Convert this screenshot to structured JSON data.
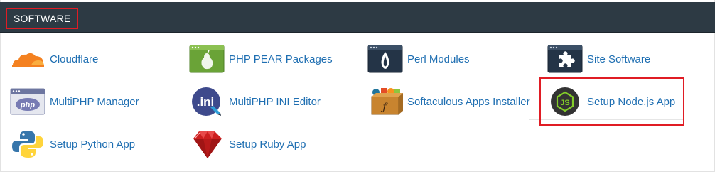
{
  "section": {
    "title": "SOFTWARE"
  },
  "items": [
    {
      "label": "Cloudflare",
      "icon": "cloudflare-icon"
    },
    {
      "label": "PHP PEAR Packages",
      "icon": "pear-icon"
    },
    {
      "label": "Perl Modules",
      "icon": "perl-onion-icon"
    },
    {
      "label": "Site Software",
      "icon": "puzzle-piece-icon"
    },
    {
      "label": "MultiPHP Manager",
      "icon": "php-window-icon"
    },
    {
      "label": "MultiPHP INI Editor",
      "icon": "ini-file-icon"
    },
    {
      "label": "Softaculous Apps Installer",
      "icon": "softaculous-box-icon"
    },
    {
      "label": "Setup Node.js App",
      "icon": "nodejs-icon"
    },
    {
      "label": "Setup Python App",
      "icon": "python-icon"
    },
    {
      "label": "Setup Ruby App",
      "icon": "ruby-gem-icon"
    }
  ],
  "colors": {
    "header_bg": "#2d3a44",
    "link": "#1f6fb2",
    "highlight": "#e01c24"
  }
}
